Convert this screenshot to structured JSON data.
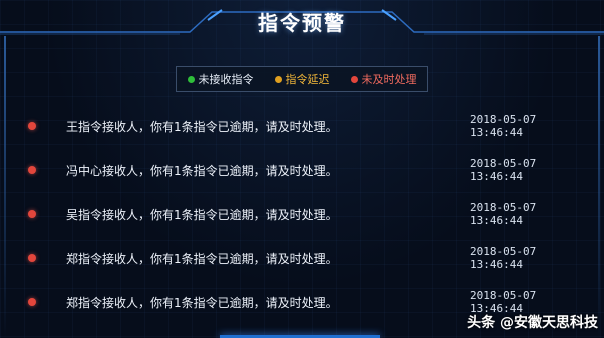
{
  "panel": {
    "title": "指令预警"
  },
  "legend": [
    {
      "label": "未接收指令",
      "color": "#2fbf3a"
    },
    {
      "label": "指令延迟",
      "color": "#e0a020"
    },
    {
      "label": "未及时处理",
      "color": "#e2463c"
    }
  ],
  "alerts": [
    {
      "message": "王指令接收人，你有1条指令已逾期，请及时处理。",
      "time": "2018-05-07 13:46:44",
      "status_color": "#e2463c"
    },
    {
      "message": "冯中心接收人，你有1条指令已逾期，请及时处理。",
      "time": "2018-05-07 13:46:44",
      "status_color": "#e2463c"
    },
    {
      "message": "吴指令接收人，你有1条指令已逾期，请及时处理。",
      "time": "2018-05-07 13:46:44",
      "status_color": "#e2463c"
    },
    {
      "message": "郑指令接收人，你有1条指令已逾期，请及时处理。",
      "time": "2018-05-07 13:46:44",
      "status_color": "#e2463c"
    },
    {
      "message": "郑指令接收人，你有1条指令已逾期，请及时处理。",
      "time": "2018-05-07 13:46:44",
      "status_color": "#e2463c"
    }
  ],
  "watermark": "头条 @安徽天思科技"
}
